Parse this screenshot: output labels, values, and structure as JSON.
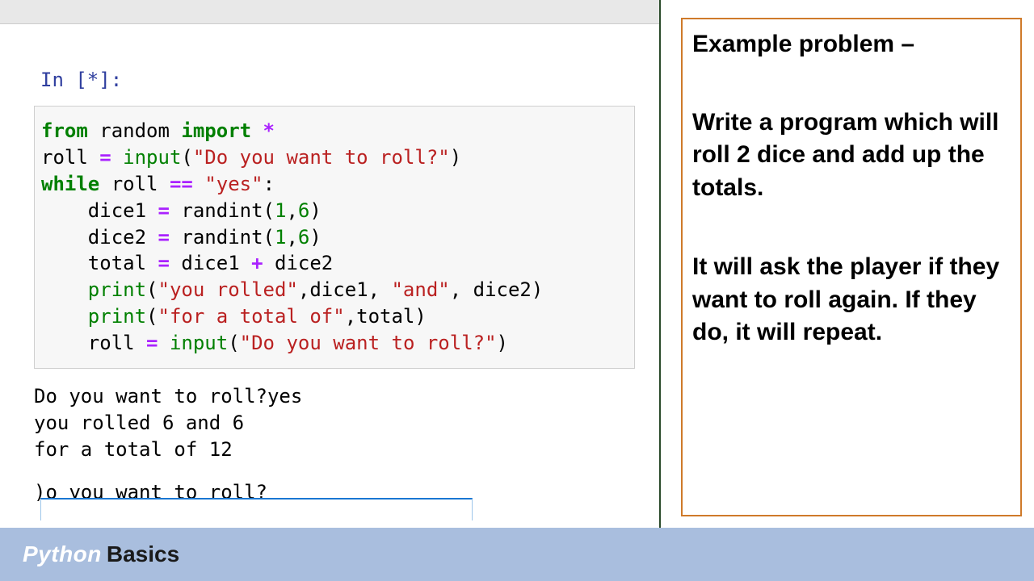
{
  "notebook": {
    "prompt_prefix": "In [",
    "prompt_status": "*",
    "prompt_suffix": "]:",
    "code_tokens": [
      {
        "t": "kw",
        "v": "from"
      },
      {
        "t": "",
        "v": " random "
      },
      {
        "t": "kw",
        "v": "import"
      },
      {
        "t": "",
        "v": " "
      },
      {
        "t": "op",
        "v": "*"
      },
      {
        "t": "nl"
      },
      {
        "t": "",
        "v": "roll "
      },
      {
        "t": "op",
        "v": "="
      },
      {
        "t": "",
        "v": " "
      },
      {
        "t": "bi",
        "v": "input"
      },
      {
        "t": "",
        "v": "("
      },
      {
        "t": "str",
        "v": "\"Do you want to roll?\""
      },
      {
        "t": "",
        "v": ")"
      },
      {
        "t": "nl"
      },
      {
        "t": "kw",
        "v": "while"
      },
      {
        "t": "",
        "v": " roll "
      },
      {
        "t": "op",
        "v": "=="
      },
      {
        "t": "",
        "v": " "
      },
      {
        "t": "str",
        "v": "\"yes\""
      },
      {
        "t": "",
        "v": ":"
      },
      {
        "t": "nl"
      },
      {
        "t": "",
        "v": "    dice1 "
      },
      {
        "t": "op",
        "v": "="
      },
      {
        "t": "",
        "v": " randint("
      },
      {
        "t": "num",
        "v": "1"
      },
      {
        "t": "",
        "v": ","
      },
      {
        "t": "num",
        "v": "6"
      },
      {
        "t": "",
        "v": ")"
      },
      {
        "t": "nl"
      },
      {
        "t": "",
        "v": "    dice2 "
      },
      {
        "t": "op",
        "v": "="
      },
      {
        "t": "",
        "v": " randint("
      },
      {
        "t": "num",
        "v": "1"
      },
      {
        "t": "",
        "v": ","
      },
      {
        "t": "num",
        "v": "6"
      },
      {
        "t": "",
        "v": ")"
      },
      {
        "t": "nl"
      },
      {
        "t": "",
        "v": "    total "
      },
      {
        "t": "op",
        "v": "="
      },
      {
        "t": "",
        "v": " dice1 "
      },
      {
        "t": "op",
        "v": "+"
      },
      {
        "t": "",
        "v": " dice2"
      },
      {
        "t": "nl"
      },
      {
        "t": "",
        "v": "    "
      },
      {
        "t": "bi",
        "v": "print"
      },
      {
        "t": "",
        "v": "("
      },
      {
        "t": "str",
        "v": "\"you rolled\""
      },
      {
        "t": "",
        "v": ",dice1, "
      },
      {
        "t": "str",
        "v": "\"and\""
      },
      {
        "t": "",
        "v": ", dice2)"
      },
      {
        "t": "nl"
      },
      {
        "t": "",
        "v": "    "
      },
      {
        "t": "bi",
        "v": "print"
      },
      {
        "t": "",
        "v": "("
      },
      {
        "t": "str",
        "v": "\"for a total of\""
      },
      {
        "t": "",
        "v": ",total)"
      },
      {
        "t": "nl"
      },
      {
        "t": "",
        "v": "    roll "
      },
      {
        "t": "op",
        "v": "="
      },
      {
        "t": "",
        "v": " "
      },
      {
        "t": "bi",
        "v": "input"
      },
      {
        "t": "",
        "v": "("
      },
      {
        "t": "str",
        "v": "\"Do you want to roll?\""
      },
      {
        "t": "",
        "v": ")"
      }
    ],
    "output_lines": [
      "Do you want to roll?yes",
      "you rolled 6 and 6",
      "for a total of 12"
    ],
    "pending_prompt": ")o you want to roll?",
    "stdin_value": ""
  },
  "problem": {
    "heading": "Example problem –",
    "p1": "Write a program which will roll 2 dice and add up the totals.",
    "p2": "It will ask the player if they want to roll again. If they do, it will repeat."
  },
  "footer": {
    "word1": "Python",
    "word2": "Basics"
  }
}
